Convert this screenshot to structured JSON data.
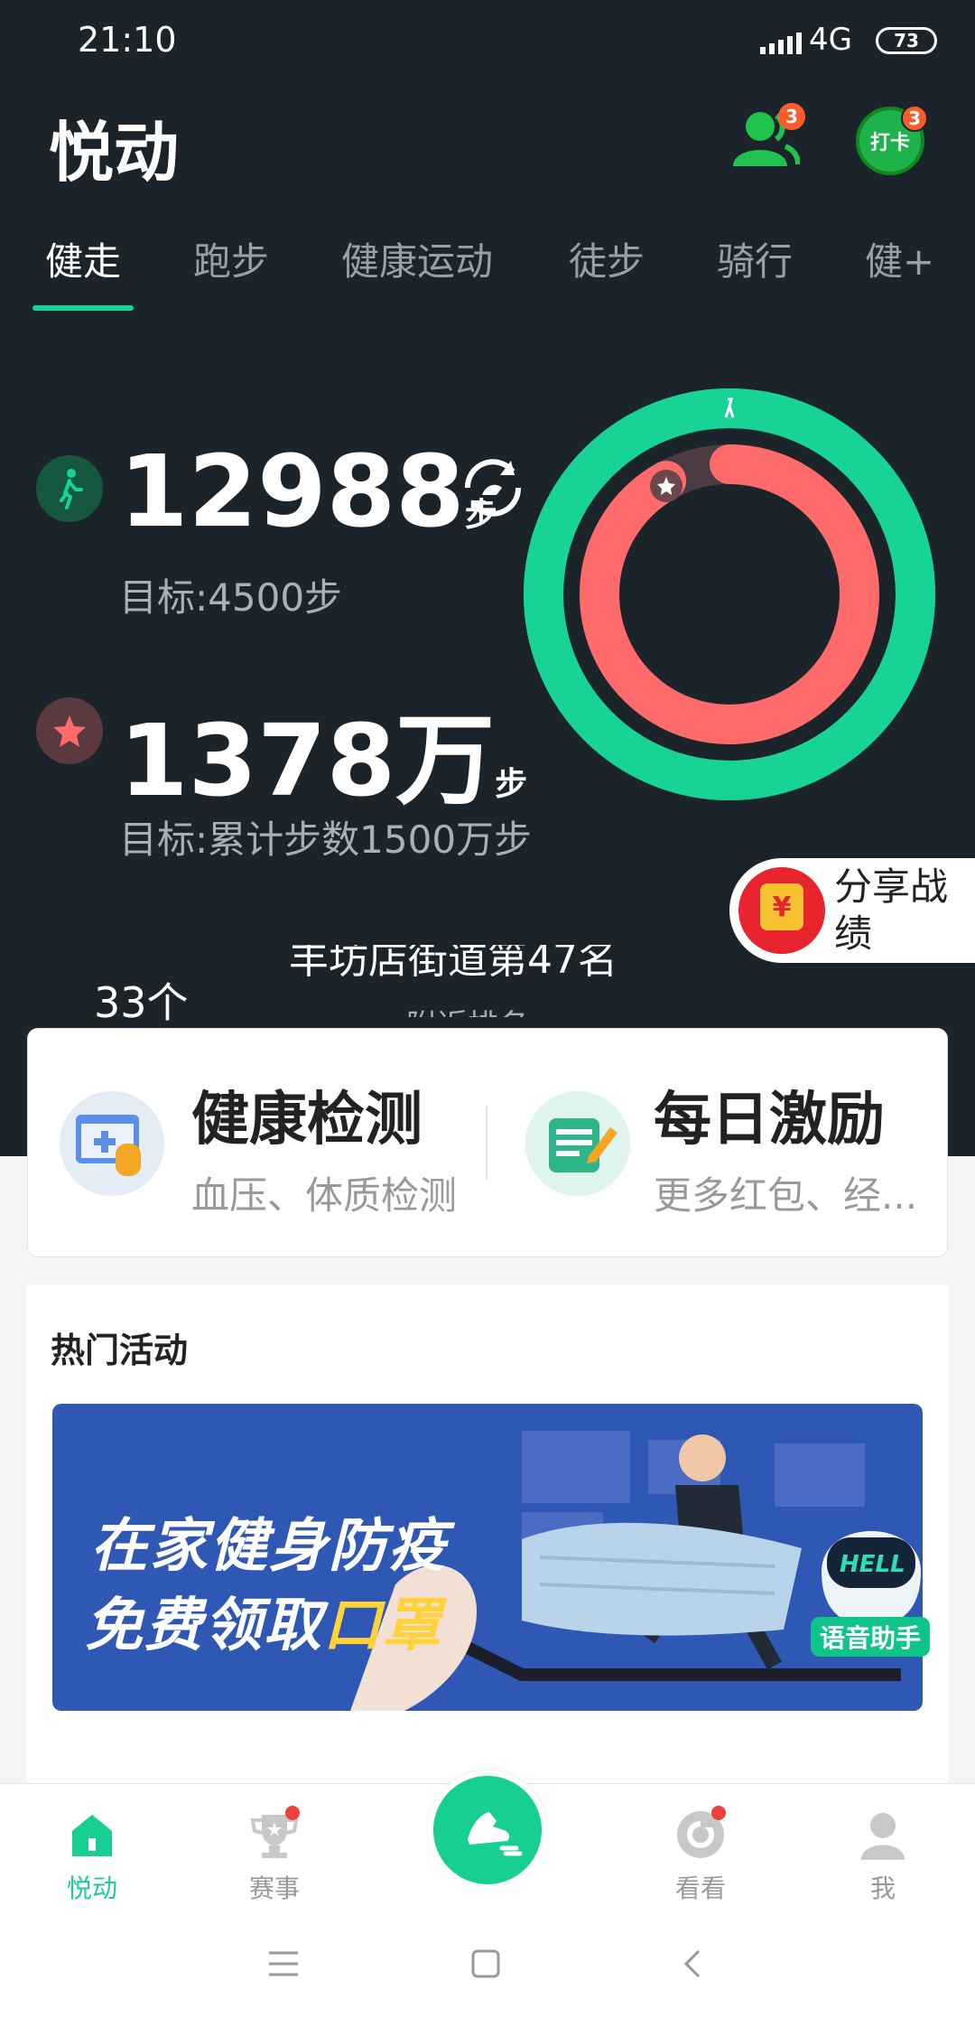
{
  "status_bar": {
    "time": "21:10",
    "network": "4G",
    "battery": "73"
  },
  "header": {
    "app_title": "悦动",
    "friends_badge": "3",
    "checkin_label": "打卡",
    "checkin_badge": "3"
  },
  "tabs": [
    "健走",
    "跑步",
    "健康运动",
    "徒步",
    "骑行",
    "健+"
  ],
  "stats": {
    "steps_value": "12988",
    "steps_unit": "步",
    "steps_goal": "目标:4500步",
    "total_value": "1378万",
    "total_unit": "步",
    "total_goal": "目标:累计步数1500万步",
    "steps_progress": 1.0,
    "total_progress": 0.919
  },
  "share": {
    "label": "分享战绩",
    "icon_glyph": "¥"
  },
  "rank": {
    "line1": "丰坊店街道第47名",
    "line2": "附近排名",
    "count": "33个"
  },
  "features": [
    {
      "title": "健康检测",
      "subtitle": "血压、体质检测"
    },
    {
      "title": "每日激励",
      "subtitle": "更多红包、经..."
    }
  ],
  "events": {
    "title": "热门活动",
    "banner_line1": "在家健身防疫",
    "banner_line2_prefix": "免费领取",
    "banner_line2_highlight": "口罩",
    "voice_assistant": "语音助手",
    "robot_text": "HELL"
  },
  "bottom_nav": [
    "悦动",
    "赛事",
    "看看",
    "我"
  ],
  "colors": {
    "accent": "#17d396",
    "ring_inner": "#ff6b6b",
    "bg_dark": "#1c242b"
  }
}
